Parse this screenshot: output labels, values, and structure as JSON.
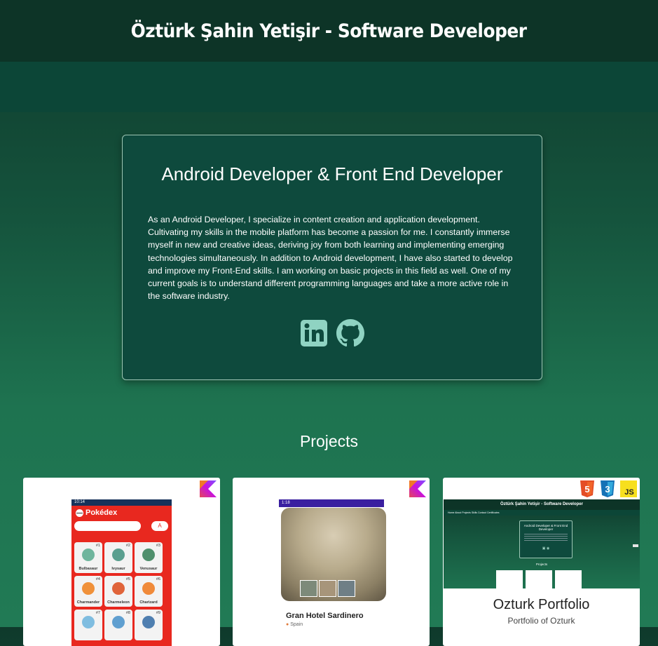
{
  "header": {
    "title": "Öztürk Şahin Yetişir - Software Developer"
  },
  "about": {
    "title": "Android Developer & Front End Developer",
    "description": "As an Android Developer, I specialize in content creation and application development. Cultivating my skills in the mobile platform has become a passion for me. I constantly immerse myself in new and creative ideas, deriving joy from both learning and implementing emerging technologies simultaneously. In addition to Android development, I have also started to develop and improve my Front-End skills. I am working on basic projects in this field as well. One of my current goals is to understand different programming languages and take a more active role in the software industry.",
    "socials": [
      {
        "icon": "linkedin-icon"
      },
      {
        "icon": "github-icon"
      }
    ]
  },
  "projects": {
    "title": "Projects",
    "items": [
      {
        "tech": [
          "kotlin-icon"
        ],
        "app_title": "Pokédex",
        "status_time": "10:14",
        "sort_label": "A",
        "pokemon": [
          {
            "num": "#1",
            "name": "Bulbasaur",
            "color": "#6fb59d"
          },
          {
            "num": "#2",
            "name": "Ivysaur",
            "color": "#5a9f8f"
          },
          {
            "num": "#3",
            "name": "Venusaur",
            "color": "#4f8f6c"
          },
          {
            "num": "#4",
            "name": "Charmander",
            "color": "#f0913a"
          },
          {
            "num": "#5",
            "name": "Charmeleon",
            "color": "#e0643a"
          },
          {
            "num": "#6",
            "name": "Charizard",
            "color": "#f08a3a"
          },
          {
            "num": "#7",
            "name": "",
            "color": "#7fbde0"
          },
          {
            "num": "#8",
            "name": "",
            "color": "#5f9fd0"
          },
          {
            "num": "#9",
            "name": "",
            "color": "#4f7fb0"
          }
        ]
      },
      {
        "tech": [
          "kotlin-icon"
        ],
        "status_time": "1:18",
        "hotel_name": "Gran Hotel Sardinero",
        "hotel_location": "Spain"
      },
      {
        "tech": [
          "html5-icon",
          "css3-icon",
          "js-icon"
        ],
        "js_label": "JS",
        "html_label": "5",
        "css_label": "3",
        "preview_title": "Öztürk Şahin Yetişir - Software Developer",
        "preview_nav": "Home  About  Projects  Skills  Contact  Certificates",
        "preview_card_title": "Android Developer & Front End Developer",
        "preview_projects": "Projects",
        "title": "Ozturk Portfolio",
        "subtitle": "Portfolio of Ozturk"
      }
    ]
  },
  "colors": {
    "header_bg": "#0d3427",
    "nav_bg": "#0c4637",
    "card_bg": "#0e4a3d",
    "icon_accent": "#8fd3c2"
  }
}
